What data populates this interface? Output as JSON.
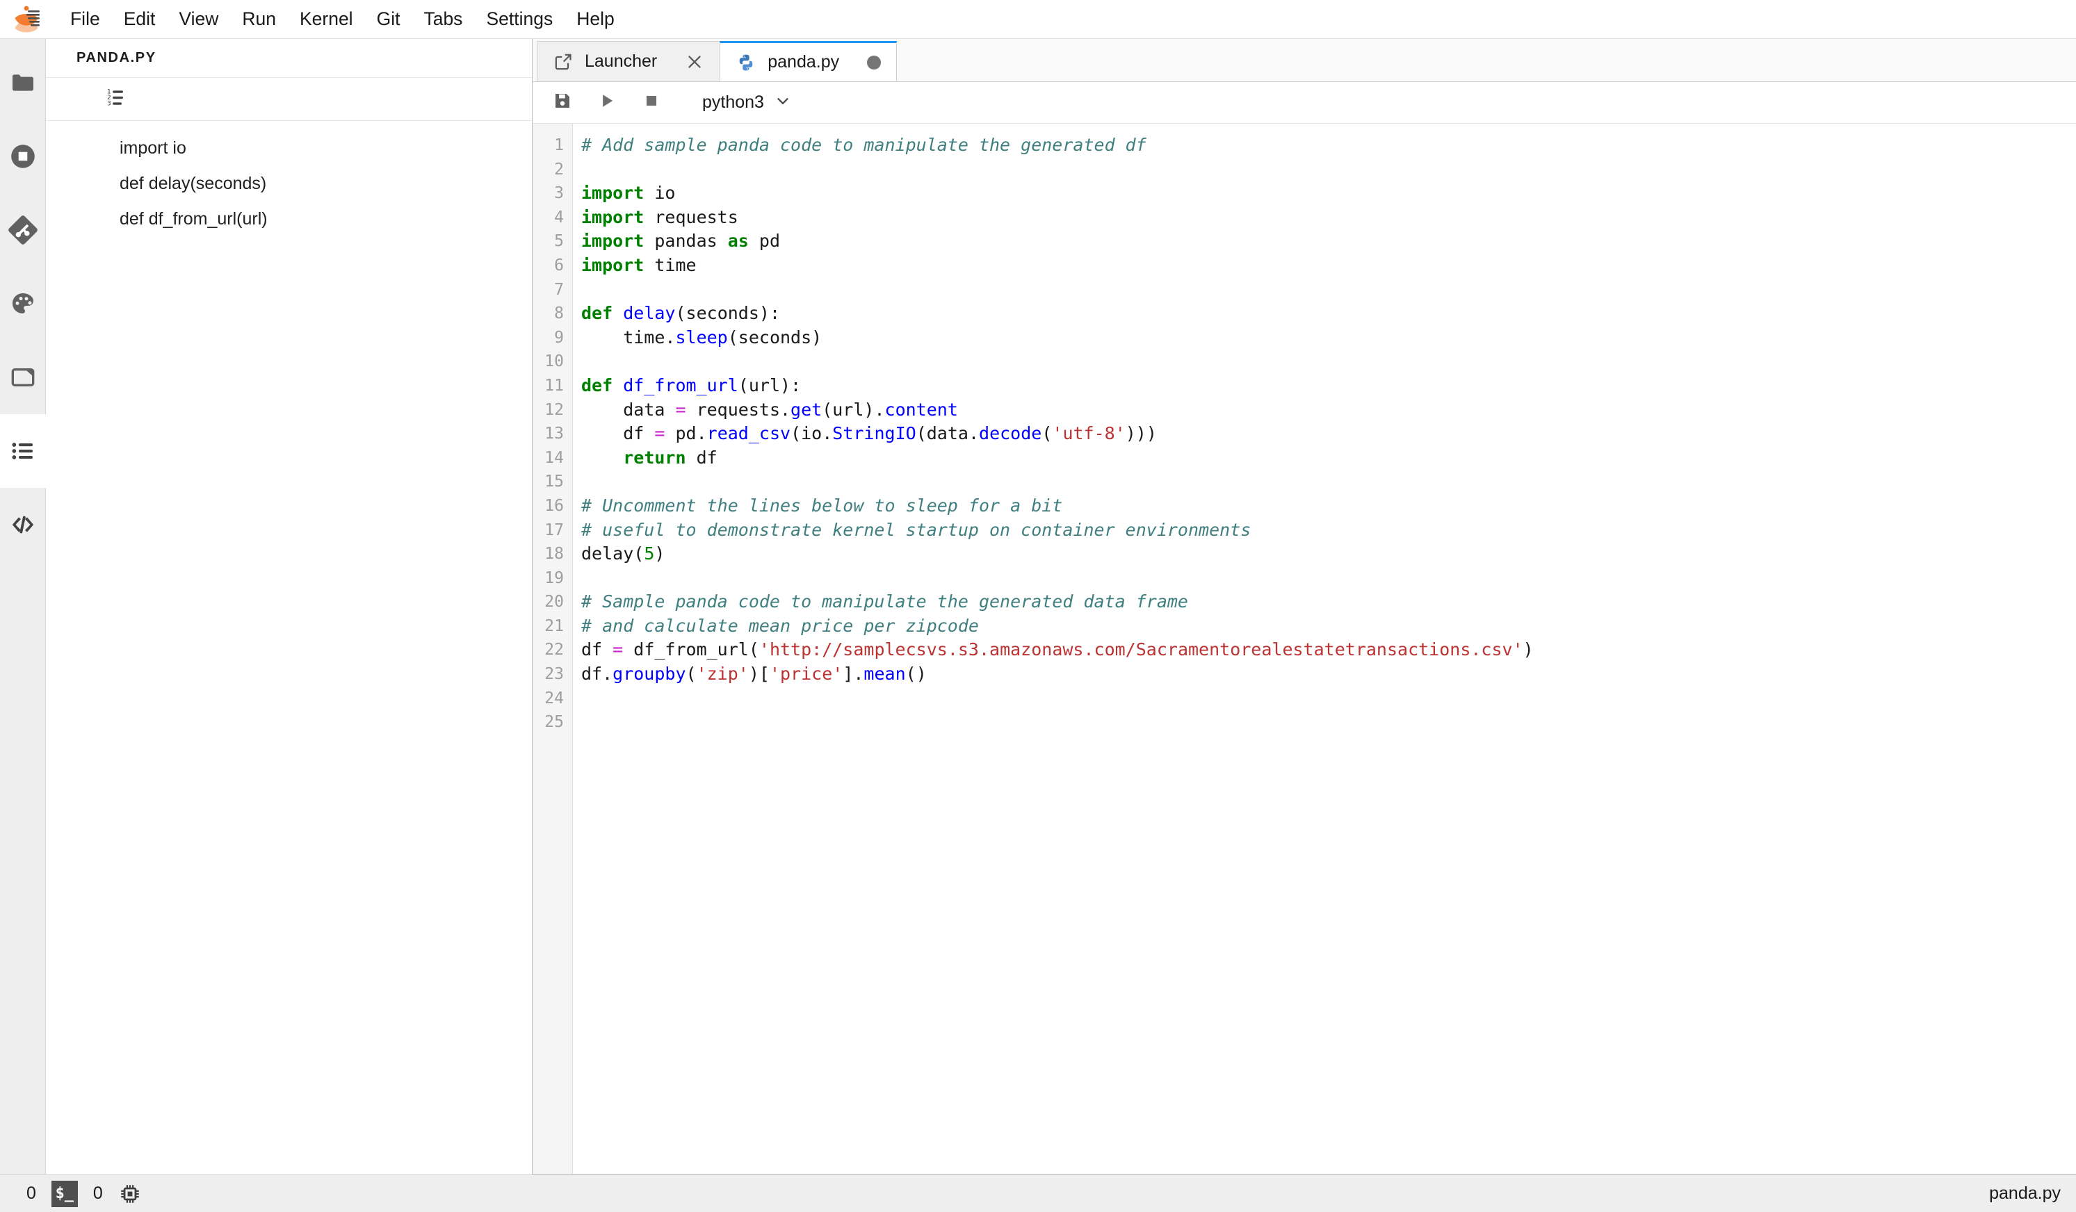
{
  "app": {
    "logo": "jupyter-logo",
    "title": "JupyterLab"
  },
  "menubar": {
    "items": [
      {
        "label": "File",
        "name": "menu-file"
      },
      {
        "label": "Edit",
        "name": "menu-edit"
      },
      {
        "label": "View",
        "name": "menu-view"
      },
      {
        "label": "Run",
        "name": "menu-run"
      },
      {
        "label": "Kernel",
        "name": "menu-kernel"
      },
      {
        "label": "Git",
        "name": "menu-git"
      },
      {
        "label": "Tabs",
        "name": "menu-tabs"
      },
      {
        "label": "Settings",
        "name": "menu-settings"
      },
      {
        "label": "Help",
        "name": "menu-help"
      }
    ]
  },
  "activitybar": {
    "top_items": [
      {
        "icon": "folder-icon",
        "name": "file-browser-button",
        "selected": false
      },
      {
        "icon": "running-terminals-icon",
        "name": "running-sessions-button",
        "selected": false
      },
      {
        "icon": "git-icon",
        "name": "git-panel-button",
        "selected": false
      },
      {
        "icon": "palette-icon",
        "name": "command-palette-button",
        "selected": false
      },
      {
        "icon": "notebook-tools-icon",
        "name": "notebook-tools-button",
        "selected": false
      },
      {
        "icon": "toc-list-icon",
        "name": "table-of-contents-button",
        "selected": true
      },
      {
        "icon": "extension-code-icon",
        "name": "extension-manager-button",
        "selected": false
      }
    ]
  },
  "sidepanel": {
    "title": "panda.py",
    "numbering_toggle": "numbered-list-icon",
    "items": [
      {
        "label": "import io"
      },
      {
        "label": "def delay(seconds)"
      },
      {
        "label": "def df_from_url(url)"
      }
    ]
  },
  "tabs": [
    {
      "label": "Launcher",
      "icon": "launcher-icon",
      "active": false,
      "closable": true,
      "dirty": false
    },
    {
      "label": "panda.py",
      "icon": "python-file-icon",
      "active": true,
      "closable": false,
      "dirty": true
    }
  ],
  "editor_toolbar": {
    "save": {
      "label": "Save",
      "icon": "save-icon"
    },
    "run": {
      "label": "Run",
      "icon": "play-icon"
    },
    "stop": {
      "label": "Stop",
      "icon": "stop-icon"
    },
    "kernel": {
      "label": "python3",
      "chevron": "chevron-down-icon"
    }
  },
  "editor": {
    "filename": "panda.py",
    "language": "python",
    "line_count": 25,
    "line_numbers": [
      1,
      2,
      3,
      4,
      5,
      6,
      7,
      8,
      9,
      10,
      11,
      12,
      13,
      14,
      15,
      16,
      17,
      18,
      19,
      20,
      21,
      22,
      23,
      24,
      25
    ],
    "lines": [
      [
        {
          "t": "comment",
          "s": "# Add sample panda code to manipulate the generated df"
        }
      ],
      [],
      [
        {
          "t": "keyword",
          "s": "import"
        },
        {
          "t": "plain",
          "s": " io"
        }
      ],
      [
        {
          "t": "keyword",
          "s": "import"
        },
        {
          "t": "plain",
          "s": " requests"
        }
      ],
      [
        {
          "t": "keyword",
          "s": "import"
        },
        {
          "t": "plain",
          "s": " pandas "
        },
        {
          "t": "keyword",
          "s": "as"
        },
        {
          "t": "plain",
          "s": " pd"
        }
      ],
      [
        {
          "t": "keyword",
          "s": "import"
        },
        {
          "t": "plain",
          "s": " time"
        }
      ],
      [],
      [
        {
          "t": "keyword",
          "s": "def"
        },
        {
          "t": "plain",
          "s": " "
        },
        {
          "t": "def",
          "s": "delay"
        },
        {
          "t": "plain",
          "s": "(seconds):"
        }
      ],
      [
        {
          "t": "plain",
          "s": "    time."
        },
        {
          "t": "def",
          "s": "sleep"
        },
        {
          "t": "plain",
          "s": "(seconds)"
        }
      ],
      [],
      [
        {
          "t": "keyword",
          "s": "def"
        },
        {
          "t": "plain",
          "s": " "
        },
        {
          "t": "def",
          "s": "df_from_url"
        },
        {
          "t": "plain",
          "s": "(url):"
        }
      ],
      [
        {
          "t": "plain",
          "s": "    data "
        },
        {
          "t": "op",
          "s": "="
        },
        {
          "t": "plain",
          "s": " requests."
        },
        {
          "t": "def",
          "s": "get"
        },
        {
          "t": "plain",
          "s": "(url)."
        },
        {
          "t": "def",
          "s": "content"
        }
      ],
      [
        {
          "t": "plain",
          "s": "    df "
        },
        {
          "t": "op",
          "s": "="
        },
        {
          "t": "plain",
          "s": " pd."
        },
        {
          "t": "def",
          "s": "read_csv"
        },
        {
          "t": "plain",
          "s": "(io."
        },
        {
          "t": "def",
          "s": "StringIO"
        },
        {
          "t": "plain",
          "s": "(data."
        },
        {
          "t": "def",
          "s": "decode"
        },
        {
          "t": "plain",
          "s": "("
        },
        {
          "t": "string",
          "s": "'utf-8'"
        },
        {
          "t": "plain",
          "s": ")))"
        }
      ],
      [
        {
          "t": "plain",
          "s": "    "
        },
        {
          "t": "keyword",
          "s": "return"
        },
        {
          "t": "plain",
          "s": " df"
        }
      ],
      [],
      [
        {
          "t": "comment",
          "s": "# Uncomment the lines below to sleep for a bit"
        }
      ],
      [
        {
          "t": "comment",
          "s": "# useful to demonstrate kernel startup on container environments"
        }
      ],
      [
        {
          "t": "plain",
          "s": "delay("
        },
        {
          "t": "number",
          "s": "5"
        },
        {
          "t": "plain",
          "s": ")"
        }
      ],
      [],
      [
        {
          "t": "comment",
          "s": "# Sample panda code to manipulate the generated data frame"
        }
      ],
      [
        {
          "t": "comment",
          "s": "# and calculate mean price per zipcode"
        }
      ],
      [
        {
          "t": "plain",
          "s": "df "
        },
        {
          "t": "op",
          "s": "="
        },
        {
          "t": "plain",
          "s": " df_from_url("
        },
        {
          "t": "string",
          "s": "'http://samplecsvs.s3.amazonaws.com/Sacramentorealestatetransactions.csv'"
        },
        {
          "t": "plain",
          "s": ")"
        }
      ],
      [
        {
          "t": "plain",
          "s": "df."
        },
        {
          "t": "def",
          "s": "groupby"
        },
        {
          "t": "plain",
          "s": "("
        },
        {
          "t": "string",
          "s": "'zip'"
        },
        {
          "t": "plain",
          "s": ")["
        },
        {
          "t": "string",
          "s": "'price'"
        },
        {
          "t": "plain",
          "s": "]."
        },
        {
          "t": "def",
          "s": "mean"
        },
        {
          "t": "plain",
          "s": "()"
        }
      ],
      [],
      []
    ]
  },
  "statusbar": {
    "kernel_count": "0",
    "terminal_icon_label": "$_",
    "terminal_count": "0",
    "resource_icon": "cpu-chip-icon",
    "filename": "panda.py"
  },
  "colors": {
    "accent": "#2196f3",
    "comment": "#3f7f7f",
    "keyword": "#008000",
    "definition": "#0000ff",
    "string": "#bb3333",
    "number": "#008000",
    "operator": "#cc22cc",
    "chrome_bg": "#eeeeee",
    "editor_bg": "#ffffff"
  }
}
